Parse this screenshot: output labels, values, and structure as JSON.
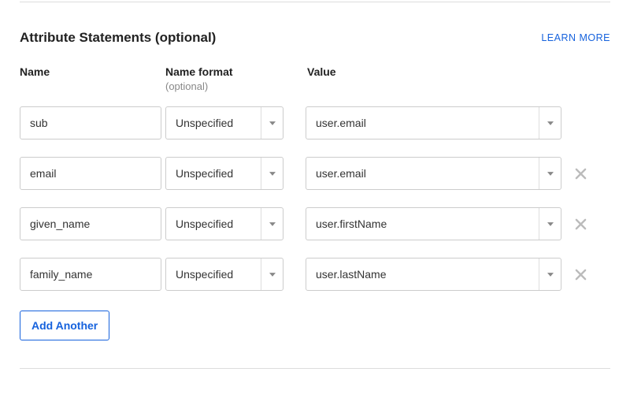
{
  "section": {
    "title": "Attribute Statements (optional)",
    "learn_more": "LEARN MORE",
    "add_another": "Add Another"
  },
  "columns": {
    "name": "Name",
    "format": "Name format",
    "format_optional": "(optional)",
    "value": "Value"
  },
  "rows": [
    {
      "name": "sub",
      "format": "Unspecified",
      "value": "user.email",
      "removable": false
    },
    {
      "name": "email",
      "format": "Unspecified",
      "value": "user.email",
      "removable": true
    },
    {
      "name": "given_name",
      "format": "Unspecified",
      "value": "user.firstName",
      "removable": true
    },
    {
      "name": "family_name",
      "format": "Unspecified",
      "value": "user.lastName",
      "removable": true
    }
  ]
}
